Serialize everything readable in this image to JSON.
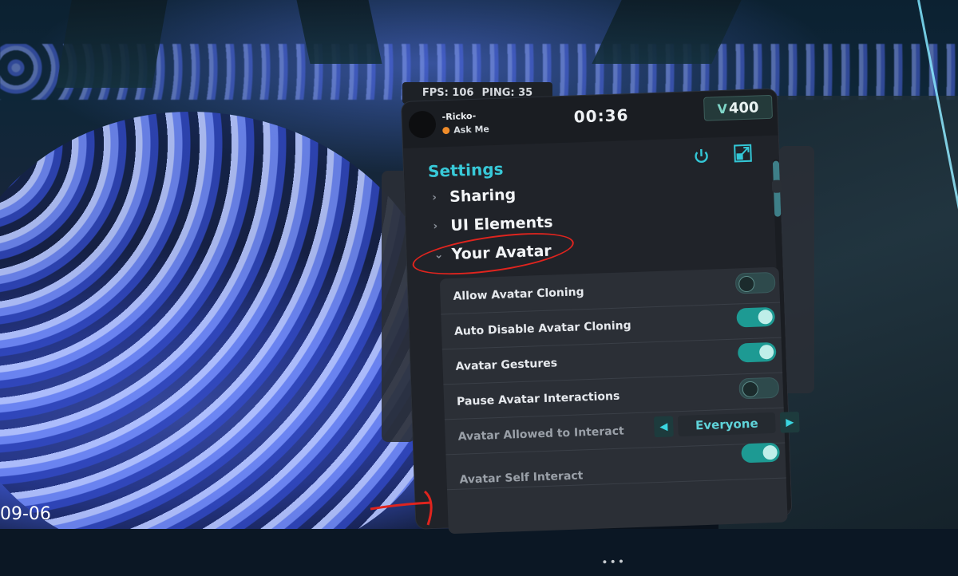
{
  "hud": {
    "fps": "FPS: 106",
    "ping": "PING: 35"
  },
  "menu": {
    "user": {
      "name": "-Ricko-",
      "status": "Ask Me",
      "status_color": "#f08c2a"
    },
    "clock": "00:36",
    "currency": {
      "symbol": "V",
      "amount": "400"
    },
    "title": "Settings",
    "sections": [
      {
        "label": "Sharing",
        "expanded": false
      },
      {
        "label": "UI Elements",
        "expanded": false
      },
      {
        "label": "Your Avatar",
        "expanded": true
      }
    ],
    "options": [
      {
        "label": "Allow Avatar Cloning",
        "control": "toggle",
        "on": false
      },
      {
        "label": "Auto Disable Avatar Cloning",
        "control": "toggle",
        "on": true
      },
      {
        "label": "Avatar Gestures",
        "control": "toggle",
        "on": true
      },
      {
        "label": "Pause Avatar Interactions",
        "control": "toggle",
        "on": false
      },
      {
        "label": "Avatar Allowed to Interact",
        "control": "selector",
        "value": "Everyone"
      },
      {
        "label": "Avatar Self Interact",
        "control": "toggle",
        "on": true
      }
    ],
    "accent": "#38c9d8"
  },
  "overlay": {
    "timestamp": "09-06"
  }
}
